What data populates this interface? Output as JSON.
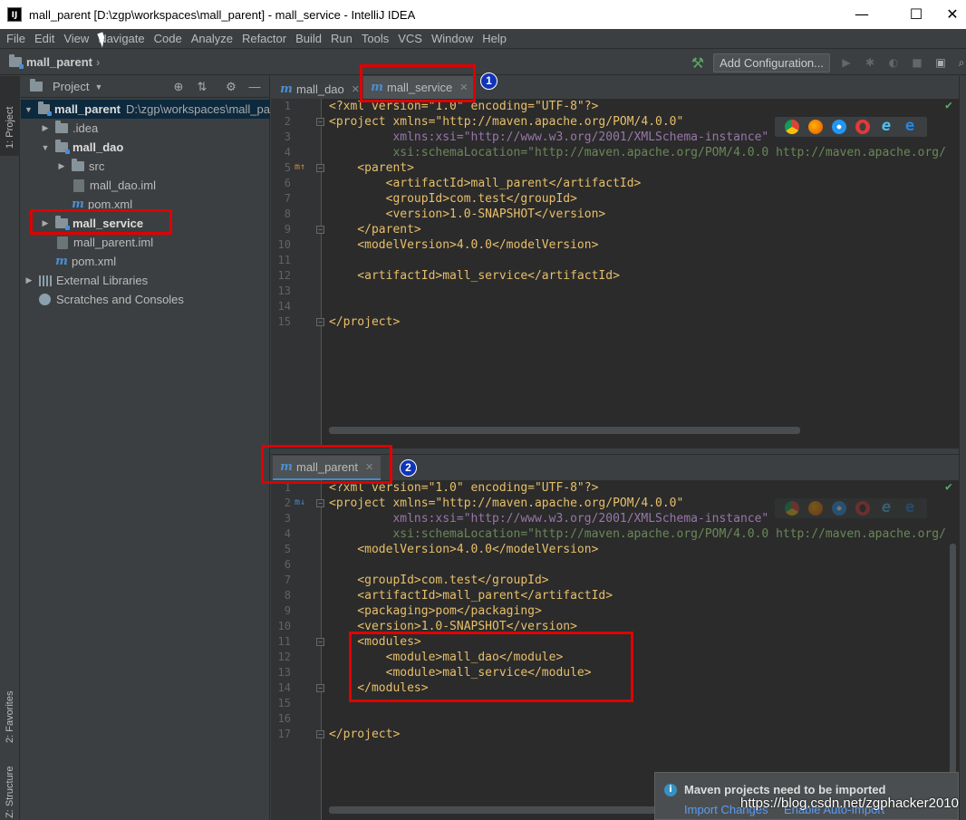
{
  "window": {
    "title": "mall_parent [D:\\zgp\\workspaces\\mall_parent] - mall_service - IntelliJ IDEA",
    "logo_text": "IJ",
    "controls": [
      "—",
      "☐",
      "✕"
    ]
  },
  "menu": [
    "File",
    "Edit",
    "View",
    "Navigate",
    "Code",
    "Analyze",
    "Refactor",
    "Build",
    "Run",
    "Tools",
    "VCS",
    "Window",
    "Help"
  ],
  "navbar": {
    "breadcrumb": "mall_parent",
    "add_configuration": "Add Configuration..."
  },
  "left_strip": {
    "project_tab": "1: Project",
    "favorites_tab": "2: Favorites",
    "structure_tab": "Z: Structure"
  },
  "project_panel": {
    "title": "Project",
    "tree": [
      {
        "label": "mall_parent",
        "path": "D:\\zgp\\workspaces\\mall_pa"
      },
      {
        "label": ".idea"
      },
      {
        "label": "mall_dao"
      },
      {
        "label": "src"
      },
      {
        "label": "mall_dao.iml"
      },
      {
        "label": "pom.xml"
      },
      {
        "label": "mall_service"
      },
      {
        "label": "mall_parent.iml"
      },
      {
        "label": "pom.xml"
      },
      {
        "label": "External Libraries"
      },
      {
        "label": "Scratches and Consoles"
      }
    ]
  },
  "top_editor": {
    "tabs": [
      {
        "label": "mall_dao",
        "active": false
      },
      {
        "label": "mall_service",
        "active": true
      }
    ],
    "line_numbers": [
      "1",
      "2",
      "3",
      "4",
      "5",
      "6",
      "7",
      "8",
      "9",
      "10",
      "11",
      "12",
      "13",
      "14",
      "15"
    ]
  },
  "bottom_editor": {
    "tabs": [
      {
        "label": "mall_parent",
        "active": true
      }
    ],
    "line_numbers": [
      "1",
      "2",
      "3",
      "4",
      "5",
      "6",
      "7",
      "8",
      "9",
      "10",
      "11",
      "12",
      "13",
      "14",
      "15",
      "16",
      "17"
    ]
  },
  "code": {
    "xml_decl": "<?xml version=\"1.0\" encoding=\"UTF-8\"?>",
    "project_open": "<project xmlns=\"http://maven.apache.org/POM/4.0.0\"",
    "xmlns_xsi": "         xmlns:xsi=\"http://www.w3.org/2001/XMLSchema-instance\"",
    "schema_loc": "         xsi:schemaLocation=\"http://maven.apache.org/POM/4.0.0 http://maven.apache.org/",
    "parent_open": "    <parent>",
    "parent_artifact": "        <artifactId>mall_parent</artifactId>",
    "parent_group": "        <groupId>com.test</groupId>",
    "parent_version": "        <version>1.0-SNAPSHOT</version>",
    "parent_close": "    </parent>",
    "model_version": "    <modelVersion>4.0.0</modelVersion>",
    "svc_artifact": "    <artifactId>mall_service</artifactId>",
    "project_close": "</project>",
    "p_group": "    <groupId>com.test</groupId>",
    "p_artifact": "    <artifactId>mall_parent</artifactId>",
    "p_packaging": "    <packaging>pom</packaging>",
    "p_version": "    <version>1.0-SNAPSHOT</version>",
    "modules_open": "    <modules>",
    "module_dao": "        <module>mall_dao</module>",
    "module_svc": "        <module>mall_service</module>",
    "modules_close": "    </modules>"
  },
  "annotations": {
    "marker1": "1",
    "marker2": "2"
  },
  "notification": {
    "title": "Maven projects need to be imported",
    "link_import": "Import Changes",
    "link_auto": "Enable Auto-Import"
  },
  "watermark": "https://blog.csdn.net/zgphacker2010",
  "colors": {
    "accent": "#4a88c7",
    "annotation_red": "#e00000",
    "marker_blue": "#1034b8"
  }
}
